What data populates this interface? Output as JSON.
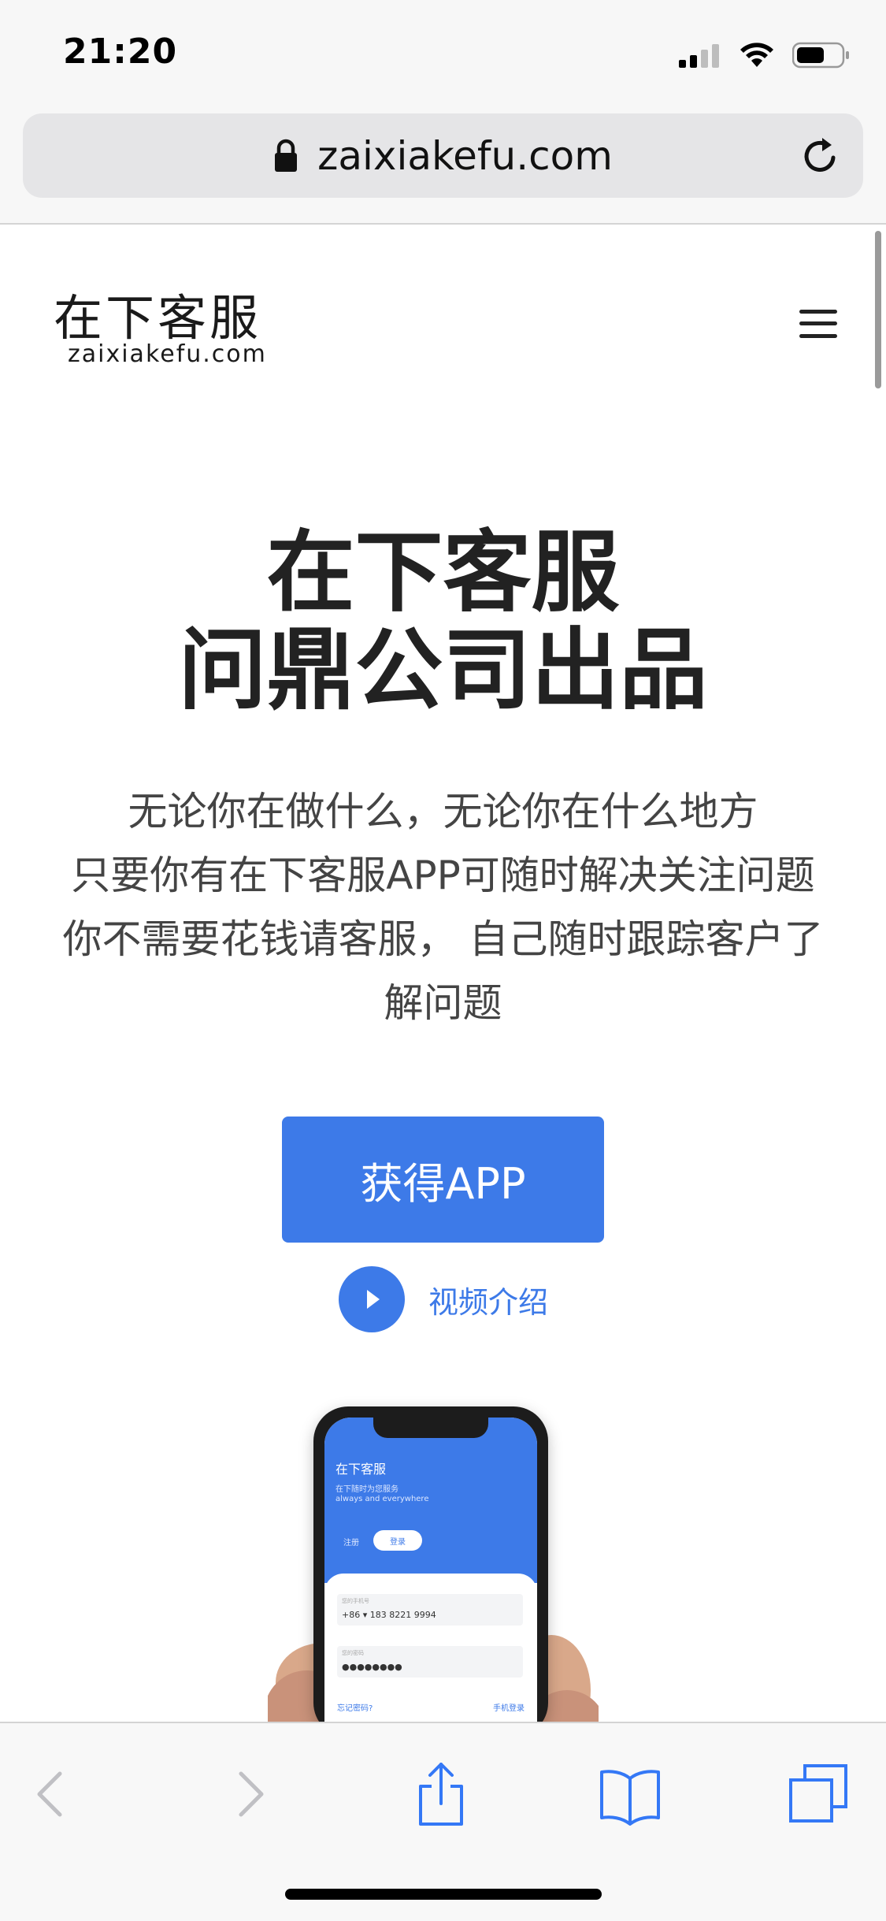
{
  "status_bar": {
    "time": "21:20",
    "icons": [
      "cellular-signal-icon",
      "wifi-icon",
      "battery-icon"
    ]
  },
  "browser": {
    "url": "zaixiakefu.com",
    "icons": [
      "lock-icon",
      "reload-icon"
    ]
  },
  "header": {
    "logo_cn": "在下客服",
    "logo_en": "zaixiakefu.com",
    "menu_icon": "hamburger-menu-icon"
  },
  "hero": {
    "title_line1": "在下客服",
    "title_line2": "问鼎公司出品",
    "desc_line1": "无论你在做什么，无论你在什么地方",
    "desc_line2": "只要你有在下客服APP可随时解决关注问题",
    "desc_line3": "你不需要花钱请客服， 自己随时跟踪客户了",
    "desc_line4": "解问题",
    "cta_label": "获得APP",
    "video_label": "视频介绍"
  },
  "phone_mockup": {
    "app_title": "在下客服",
    "subtitle": "在下随时为您服务",
    "subtitle_en": "always and everywhere",
    "tab_register": "注册",
    "tab_login": "登录",
    "phone_label": "您的手机号",
    "phone_value": "+86 ▾ 183 8221 9994",
    "password_label": "您的密码",
    "password_value": "●●●●●●●●",
    "forgot": "忘记密码?",
    "phone_login": "手机登录"
  },
  "toolbar": {
    "items": [
      "back-icon",
      "forward-icon",
      "share-icon",
      "bookmarks-icon",
      "tabs-icon"
    ]
  },
  "colors": {
    "accent": "#3d7ae8",
    "text_dark": "#222222",
    "text_body": "#444444",
    "chrome_bg": "#f7f7f7",
    "url_bar_bg": "#e5e5e7",
    "toolbar_icon_active": "#3478f6",
    "toolbar_icon_disabled": "#c0c0c4"
  }
}
